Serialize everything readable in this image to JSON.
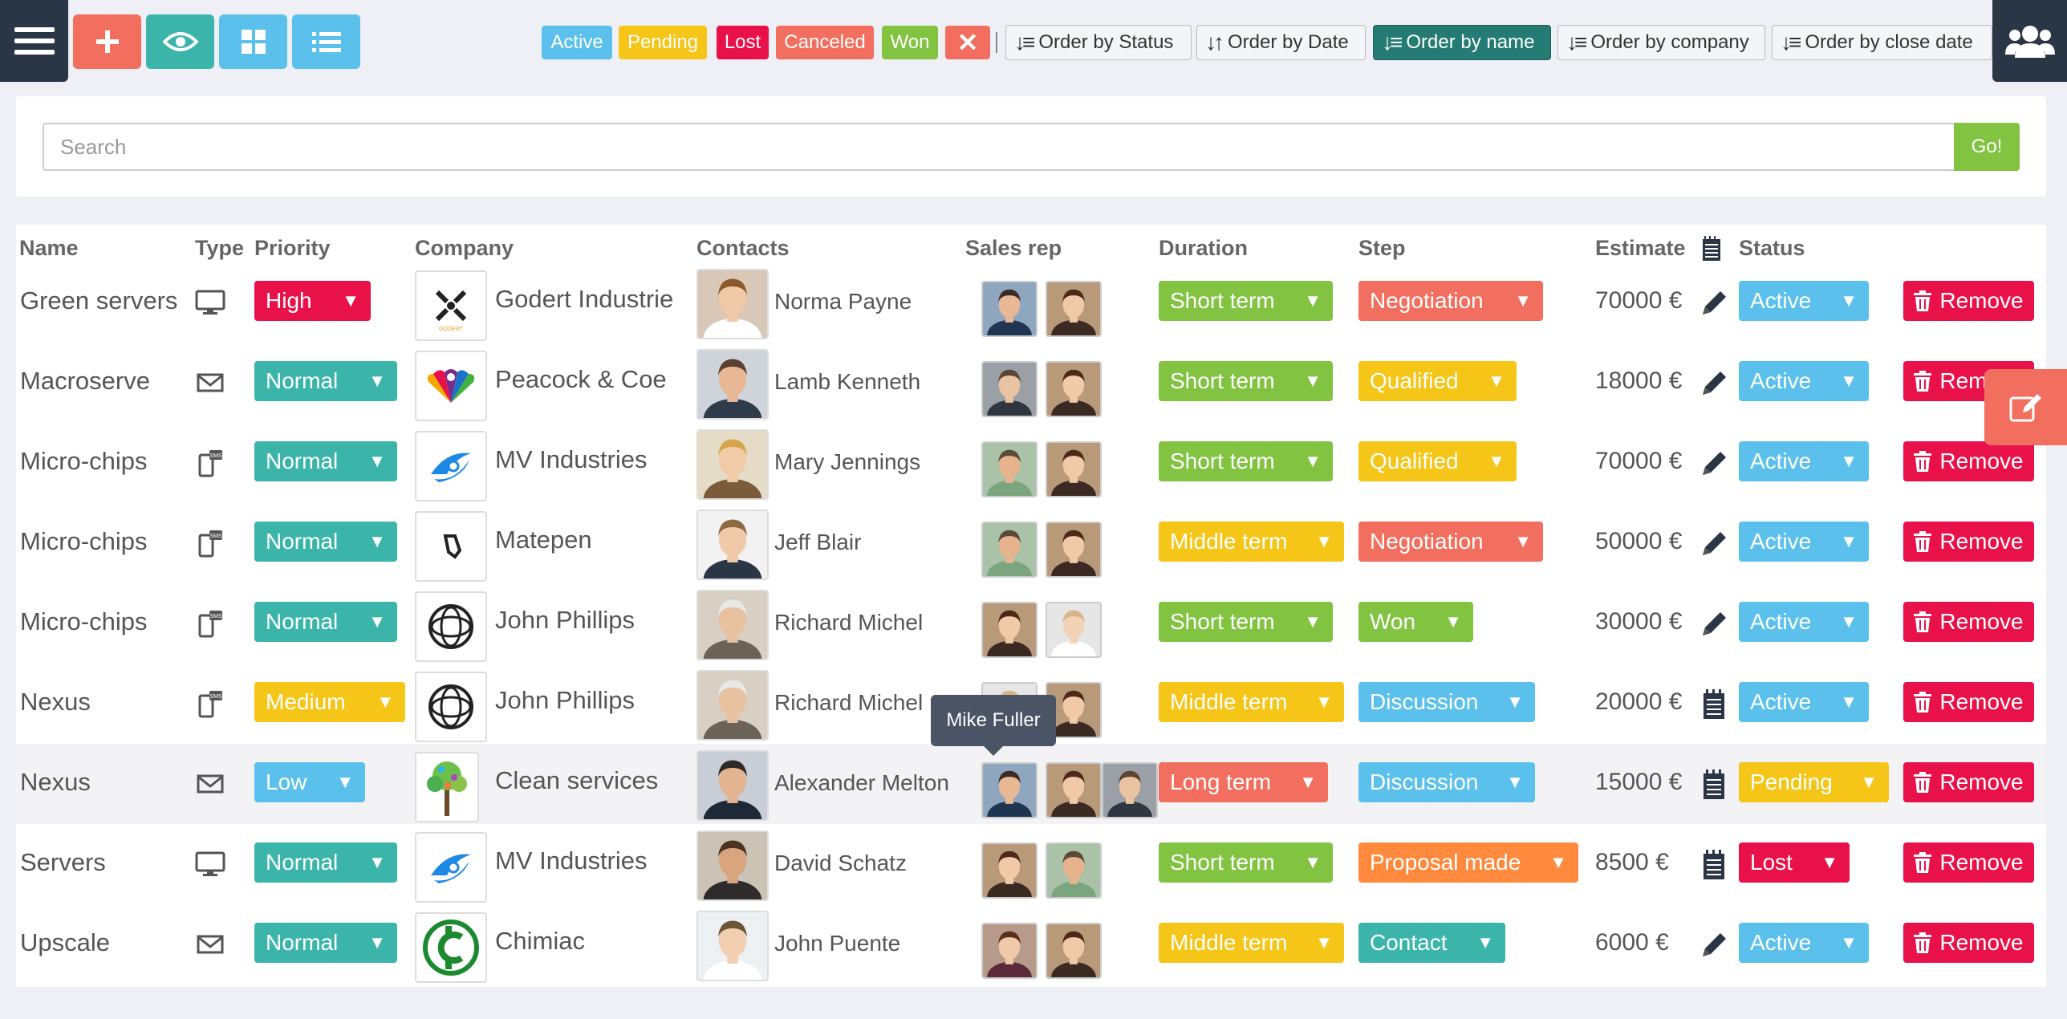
{
  "toolbar": {
    "menu_icon": "hamburger-icon",
    "add_icon": "plus-icon",
    "view_icon": "eye-icon",
    "grid_icon": "grid-icon",
    "list_icon": "list-icon",
    "users_icon": "users-icon"
  },
  "filters": {
    "active": "Active",
    "pending": "Pending",
    "lost": "Lost",
    "canceled": "Canceled",
    "won": "Won",
    "clear": "✕"
  },
  "order": {
    "status": "Order by Status",
    "date": "Order by Date",
    "name": "Order by name",
    "company": "Order by company",
    "close_date": "Order by close date",
    "selected": "name"
  },
  "search": {
    "placeholder": "Search",
    "go_label": "Go!"
  },
  "table": {
    "headers": {
      "name": "Name",
      "type": "Type",
      "priority": "Priority",
      "company": "Company",
      "contacts": "Contacts",
      "sales_rep": "Sales rep",
      "duration": "Duration",
      "step": "Step",
      "estimate": "Estimate",
      "status": "Status"
    },
    "remove_label": "Remove",
    "rows": [
      {
        "name": "Green servers",
        "type": "monitor-icon",
        "priority": "High",
        "company": "Godert Industrie",
        "contact": "Norma Payne",
        "duration": "Short term",
        "step": "Negotiation",
        "estimate": "70000 €",
        "est_icon": "pencil-icon",
        "status": "Active"
      },
      {
        "name": "Macroserve",
        "type": "envelope-icon",
        "priority": "Normal",
        "company": "Peacock & Coe",
        "contact": "Lamb Kenneth",
        "duration": "Short term",
        "step": "Qualified",
        "estimate": "18000 €",
        "est_icon": "pencil-icon",
        "status": "Active"
      },
      {
        "name": "Micro-chips",
        "type": "sms-icon",
        "priority": "Normal",
        "company": "MV Industries",
        "contact": "Mary Jennings",
        "duration": "Short term",
        "step": "Qualified",
        "estimate": "70000 €",
        "est_icon": "pencil-icon",
        "status": "Active"
      },
      {
        "name": "Micro-chips",
        "type": "sms-icon",
        "priority": "Normal",
        "company": "Matepen",
        "contact": "Jeff Blair",
        "duration": "Middle term",
        "step": "Negotiation",
        "estimate": "50000 €",
        "est_icon": "pencil-icon",
        "status": "Active"
      },
      {
        "name": "Micro-chips",
        "type": "sms-icon",
        "priority": "Normal",
        "company": "John Phillips",
        "contact": "Richard Michel",
        "duration": "Short term",
        "step": "Won",
        "estimate": "30000 €",
        "est_icon": "pencil-icon",
        "status": "Active"
      },
      {
        "name": "Nexus",
        "type": "sms-icon",
        "priority": "Medium",
        "company": "John Phillips",
        "contact": "Richard Michel",
        "duration": "Middle term",
        "step": "Discussion",
        "estimate": "20000 €",
        "est_icon": "notepad-icon",
        "status": "Active"
      },
      {
        "name": "Nexus",
        "type": "envelope-icon",
        "priority": "Low",
        "company": "Clean services",
        "contact": "Alexander Melton",
        "duration": "Long term",
        "step": "Discussion",
        "estimate": "15000 €",
        "est_icon": "notepad-icon",
        "status": "Pending"
      },
      {
        "name": "Servers",
        "type": "monitor-icon",
        "priority": "Normal",
        "company": "MV Industries",
        "contact": "David Schatz",
        "duration": "Short term",
        "step": "Proposal made",
        "estimate": "8500 €",
        "est_icon": "notepad-icon",
        "status": "Lost"
      },
      {
        "name": "Upscale",
        "type": "envelope-icon",
        "priority": "Normal",
        "company": "Chimiac",
        "contact": "John Puente",
        "duration": "Middle term",
        "step": "Contact",
        "estimate": "6000 €",
        "est_icon": "pencil-icon",
        "status": "Active"
      }
    ]
  },
  "tooltip": "Mike Fuller",
  "colors": {
    "red": "#e8114a",
    "teal": "#3bb5a9",
    "yellow": "#f5c518",
    "blue": "#5bc0eb",
    "green": "#82c341",
    "coral": "#f26e5e",
    "orange": "#ff8a3d",
    "navy": "#2a3545",
    "selected_order": "#247b74"
  }
}
